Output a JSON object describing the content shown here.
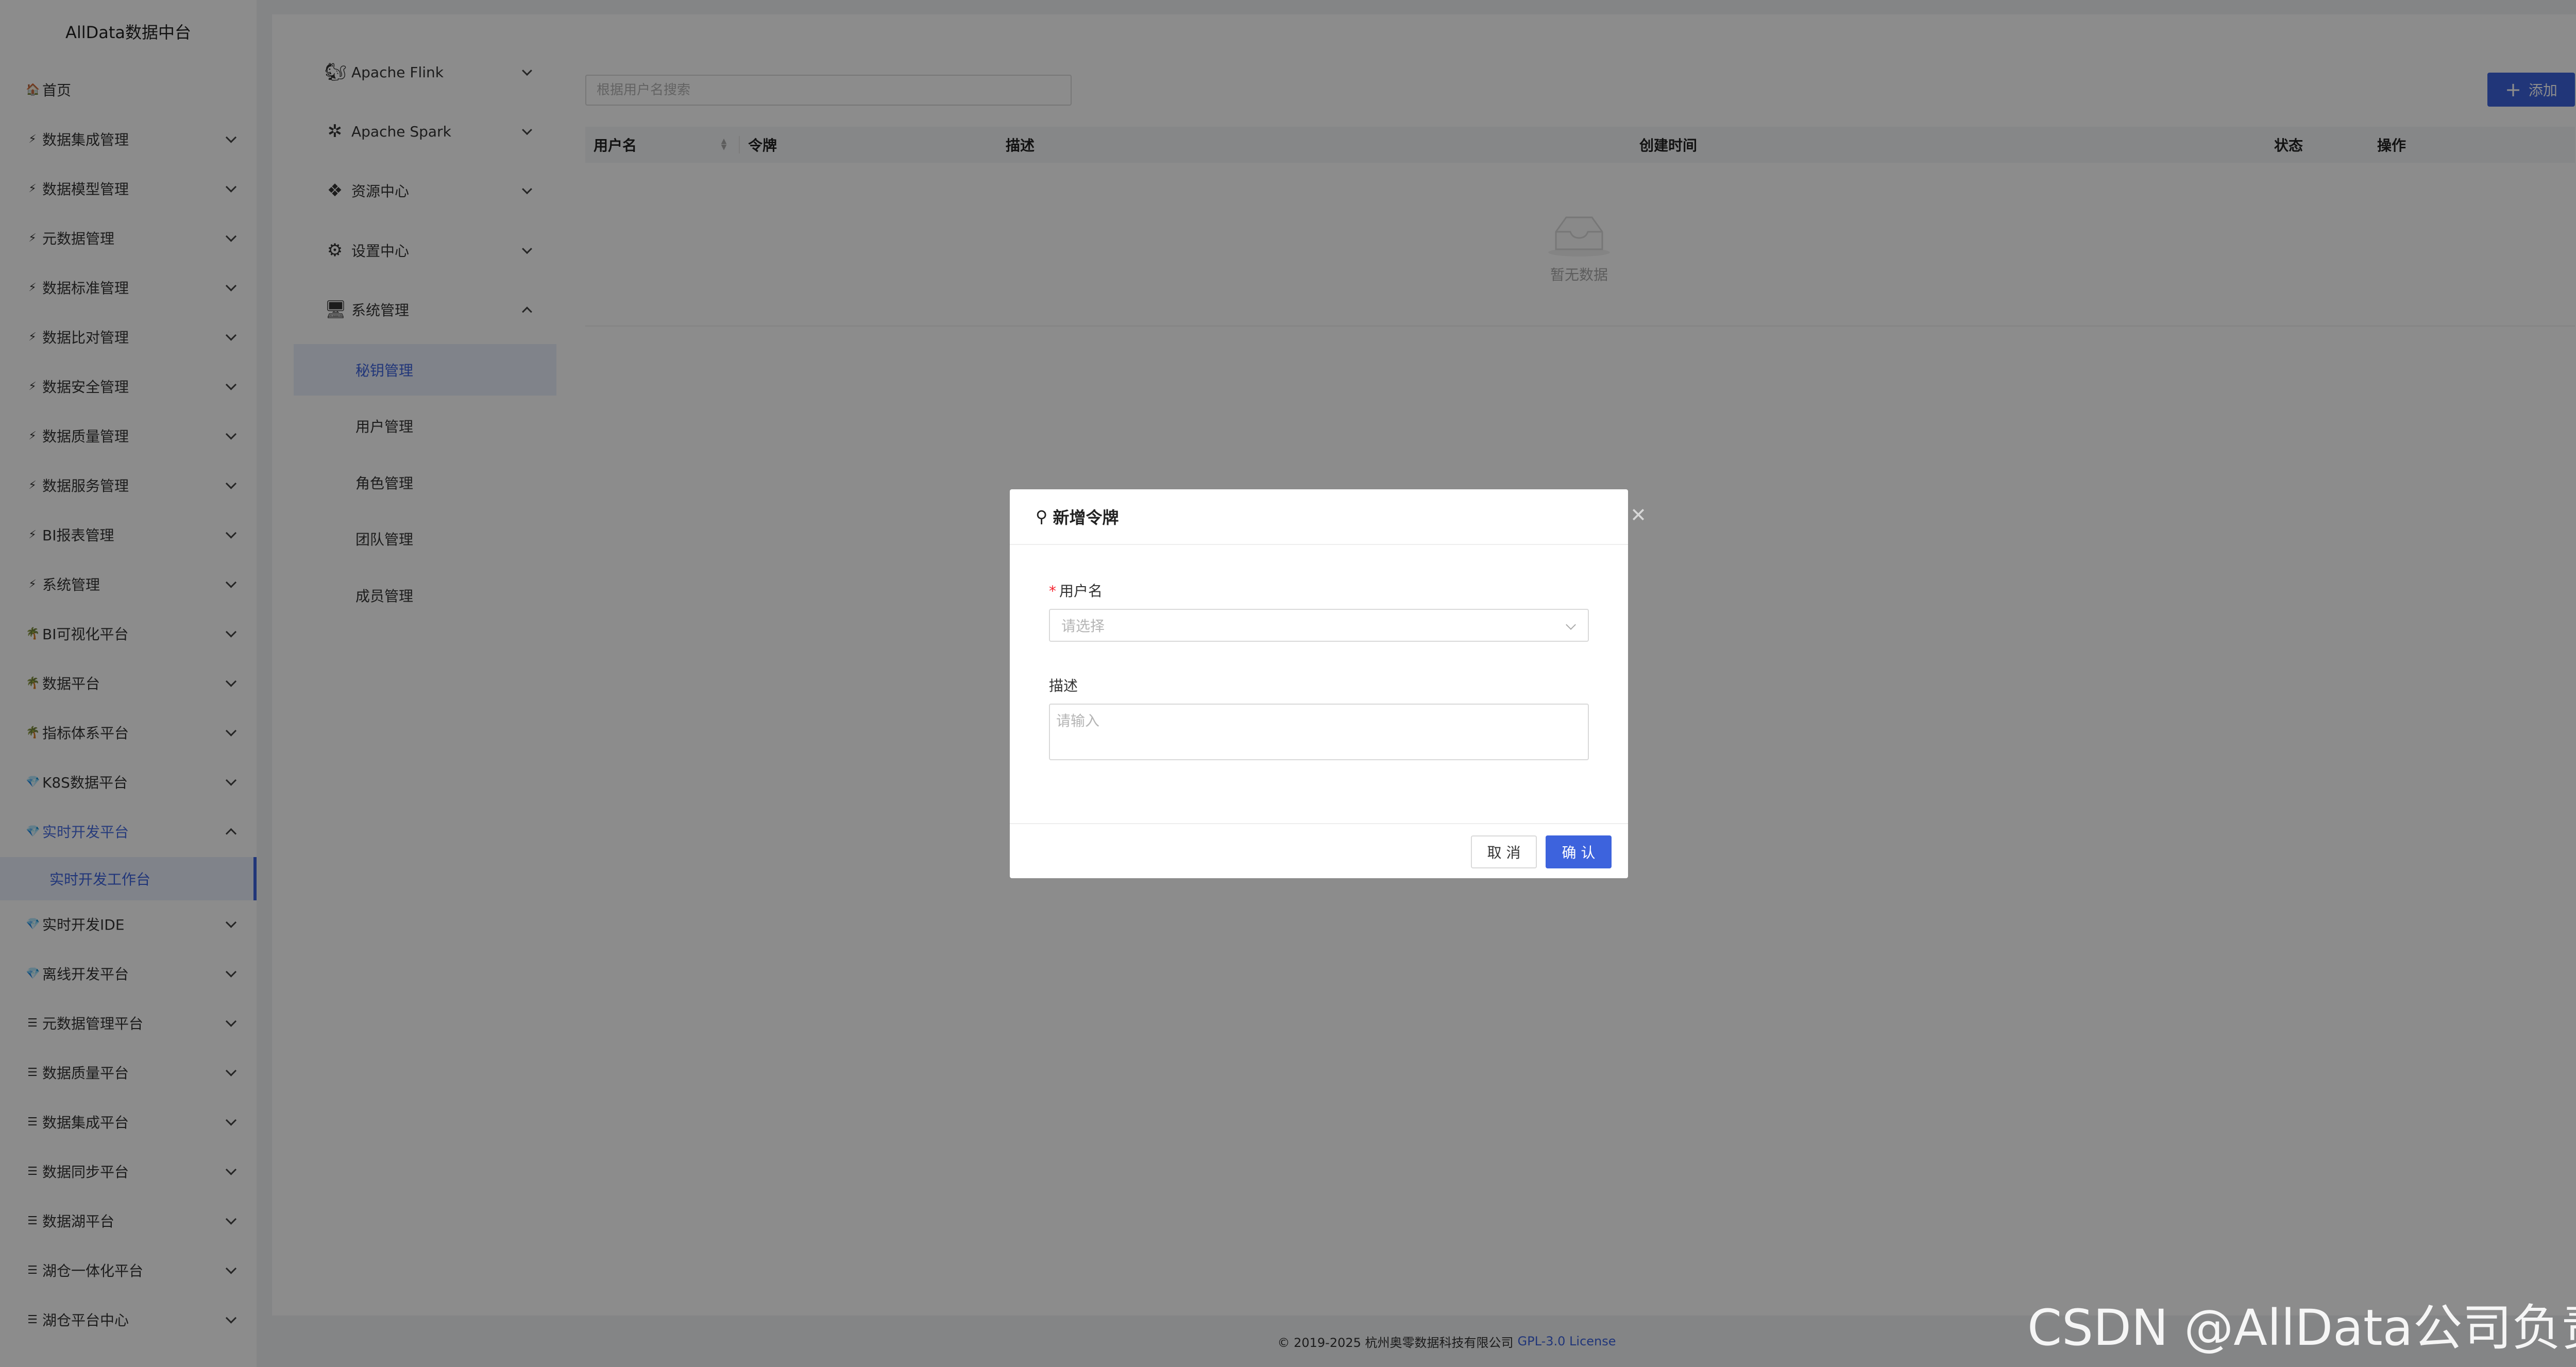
{
  "app": {
    "title": "AllData数据中台"
  },
  "sidebar": {
    "items": [
      {
        "label": "首页",
        "icon": "home-icon",
        "glyph": "🏠"
      },
      {
        "label": "数据集成管理",
        "icon": "bolt-icon",
        "glyph": "⚡"
      },
      {
        "label": "数据模型管理",
        "icon": "bolt-icon",
        "glyph": "⚡"
      },
      {
        "label": "元数据管理",
        "icon": "bolt-icon",
        "glyph": "⚡"
      },
      {
        "label": "数据标准管理",
        "icon": "bolt-icon",
        "glyph": "⚡"
      },
      {
        "label": "数据比对管理",
        "icon": "bolt-icon",
        "glyph": "⚡"
      },
      {
        "label": "数据安全管理",
        "icon": "bolt-icon",
        "glyph": "⚡"
      },
      {
        "label": "数据质量管理",
        "icon": "bolt-icon",
        "glyph": "⚡"
      },
      {
        "label": "数据服务管理",
        "icon": "bolt-icon",
        "glyph": "⚡"
      },
      {
        "label": "BI报表管理",
        "icon": "bolt-icon",
        "glyph": "⚡"
      },
      {
        "label": "系统管理",
        "icon": "bolt-icon",
        "glyph": "⚡"
      },
      {
        "label": "BI可视化平台",
        "icon": "tree-icon",
        "glyph": "🌴"
      },
      {
        "label": "数据平台",
        "icon": "tree-icon",
        "glyph": "🌴"
      },
      {
        "label": "指标体系平台",
        "icon": "tree-icon",
        "glyph": "🌴"
      },
      {
        "label": "K8S数据平台",
        "icon": "gem-icon",
        "glyph": "💎"
      },
      {
        "label": "实时开发平台",
        "icon": "gem-icon",
        "glyph": "💎"
      },
      {
        "label": "实时开发IDE",
        "icon": "gem-icon",
        "glyph": "💎"
      },
      {
        "label": "离线开发平台",
        "icon": "gem-icon",
        "glyph": "💎"
      },
      {
        "label": "元数据管理平台",
        "icon": "list-icon",
        "glyph": "☰"
      },
      {
        "label": "数据质量平台",
        "icon": "list-icon",
        "glyph": "☰"
      },
      {
        "label": "数据集成平台",
        "icon": "list-icon",
        "glyph": "☰"
      },
      {
        "label": "数据同步平台",
        "icon": "list-icon",
        "glyph": "☰"
      },
      {
        "label": "数据湖平台",
        "icon": "list-icon",
        "glyph": "☰"
      },
      {
        "label": "湖仓一体化平台",
        "icon": "list-icon",
        "glyph": "☰"
      },
      {
        "label": "湖仓平台中心",
        "icon": "list-icon",
        "glyph": "☰"
      }
    ],
    "active_sub_item": "实时开发工作台"
  },
  "submenu": {
    "groups": [
      {
        "label": "Apache Flink",
        "icon": "flink-icon",
        "glyph": "🐿"
      },
      {
        "label": "Apache Spark",
        "icon": "spark-icon",
        "glyph": "✲"
      },
      {
        "label": "资源中心",
        "icon": "resource-icon",
        "glyph": "❖"
      },
      {
        "label": "设置中心",
        "icon": "settings-icon",
        "glyph": "⚙"
      },
      {
        "label": "系统管理",
        "icon": "monitor-icon",
        "glyph": "🖥"
      }
    ],
    "sub_items": [
      "秘钥管理",
      "用户管理",
      "角色管理",
      "团队管理",
      "成员管理"
    ]
  },
  "toolbar": {
    "search_placeholder": "根据用户名搜索",
    "add_label": "添加"
  },
  "table": {
    "columns": [
      "用户名",
      "令牌",
      "描述",
      "创建时间",
      "状态",
      "操作"
    ],
    "empty_text": "暂无数据"
  },
  "modal": {
    "title": "新增令牌",
    "username_label": "用户名",
    "username_placeholder": "请选择",
    "description_label": "描述",
    "description_placeholder": "请输入",
    "cancel_label": "取 消",
    "confirm_label": "确 认",
    "close_glyph": "✕"
  },
  "footer": {
    "copyright": "© 2019-2025 杭州奥零数据科技有限公司",
    "license": "GPL-3.0 License"
  },
  "watermark": "CSDN @AllData公司负责人",
  "colors": {
    "primary": "#3d63dd",
    "overlay": "rgba(0,0,0,0.45)",
    "required": "#f5222d"
  }
}
